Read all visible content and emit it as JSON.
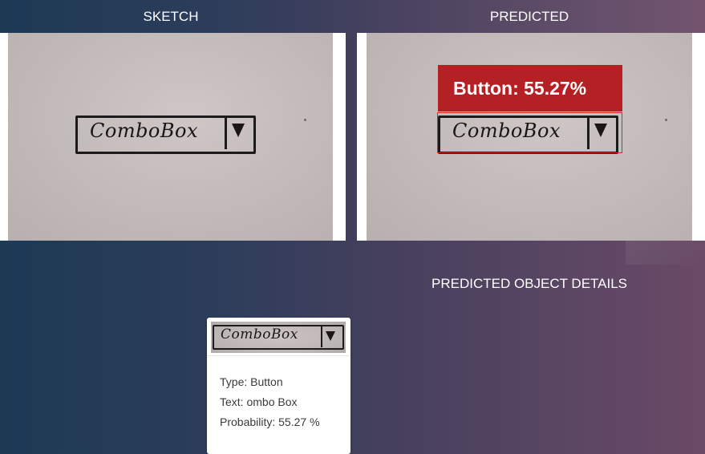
{
  "header": {
    "sketch_title": "SKETCH",
    "predicted_title": "PREDICTED"
  },
  "sketch": {
    "handwritten_text": "ComboBox"
  },
  "prediction": {
    "label": "Button: 55.27%",
    "color": "#b52024"
  },
  "details": {
    "title": "PREDICTED OBJECT DETAILS",
    "items": [
      {
        "type": "Type: Button",
        "text": "Text: ombo Box",
        "probability": "Probability: 55.27 %"
      }
    ]
  },
  "icons": {
    "dropdown_arrow": "triangle-down-icon"
  }
}
